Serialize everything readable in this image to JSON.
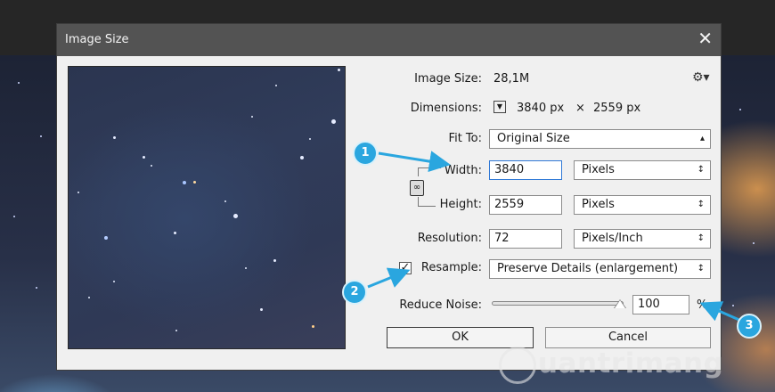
{
  "dialog": {
    "title": "Image Size",
    "close_glyph": "✕",
    "gear_icon": "gear-icon",
    "image_size": {
      "label": "Image Size:",
      "value": "28,1M"
    },
    "dimensions": {
      "label": "Dimensions:",
      "width": "3840 px",
      "times": "×",
      "height": "2559 px"
    },
    "fit_to": {
      "label": "Fit To:",
      "selected": "Original Size"
    },
    "width": {
      "label": "Width:",
      "value": "3840",
      "unit": "Pixels"
    },
    "height": {
      "label": "Height:",
      "value": "2559",
      "unit": "Pixels"
    },
    "resolution": {
      "label": "Resolution:",
      "value": "72",
      "unit": "Pixels/Inch"
    },
    "resample": {
      "label": "Resample:",
      "checked": true,
      "selected": "Preserve Details (enlargement)"
    },
    "reduce_noise": {
      "label": "Reduce Noise:",
      "value": "100",
      "unit": "%",
      "level_percent": 100
    },
    "ok_label": "OK",
    "cancel_label": "Cancel"
  },
  "callouts": [
    "1",
    "2",
    "3"
  ],
  "watermark": {
    "text": "uantrimang"
  },
  "colors": {
    "callout": "#2aa6df",
    "titlebar": "#535353",
    "dialog_bg": "#f0f0f0"
  }
}
